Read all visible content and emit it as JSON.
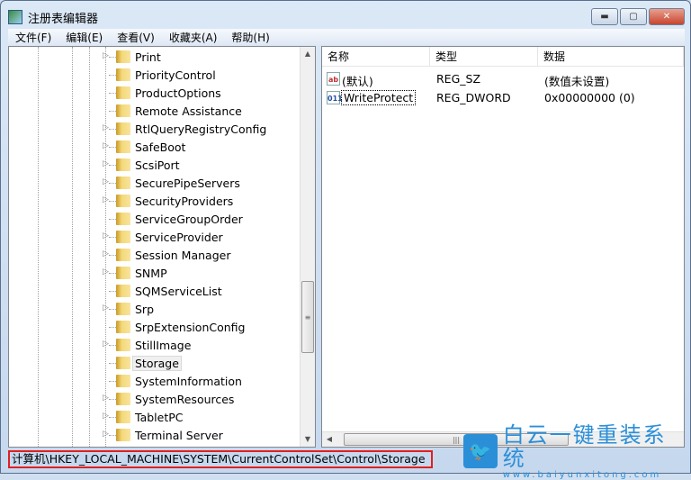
{
  "window": {
    "title": "注册表编辑器",
    "min": "▬",
    "max": "▢",
    "close": "✕"
  },
  "menu": [
    "文件(F)",
    "编辑(E)",
    "查看(V)",
    "收藏夹(A)",
    "帮助(H)"
  ],
  "tree": [
    {
      "label": "Print",
      "expandable": true
    },
    {
      "label": "PriorityControl",
      "expandable": false
    },
    {
      "label": "ProductOptions",
      "expandable": false
    },
    {
      "label": "Remote Assistance",
      "expandable": false
    },
    {
      "label": "RtlQueryRegistryConfig",
      "expandable": true
    },
    {
      "label": "SafeBoot",
      "expandable": true
    },
    {
      "label": "ScsiPort",
      "expandable": true
    },
    {
      "label": "SecurePipeServers",
      "expandable": true
    },
    {
      "label": "SecurityProviders",
      "expandable": true
    },
    {
      "label": "ServiceGroupOrder",
      "expandable": false
    },
    {
      "label": "ServiceProvider",
      "expandable": true
    },
    {
      "label": "Session Manager",
      "expandable": true
    },
    {
      "label": "SNMP",
      "expandable": true
    },
    {
      "label": "SQMServiceList",
      "expandable": false
    },
    {
      "label": "Srp",
      "expandable": true
    },
    {
      "label": "SrpExtensionConfig",
      "expandable": false
    },
    {
      "label": "StillImage",
      "expandable": true
    },
    {
      "label": "Storage",
      "expandable": false,
      "selected": true
    },
    {
      "label": "SystemInformation",
      "expandable": false
    },
    {
      "label": "SystemResources",
      "expandable": true
    },
    {
      "label": "TabletPC",
      "expandable": true
    },
    {
      "label": "Terminal Server",
      "expandable": true
    }
  ],
  "list": {
    "headers": [
      "名称",
      "类型",
      "数据"
    ],
    "rows": [
      {
        "icon": "string-value-icon",
        "icon_text": "ab",
        "name": "(默认)",
        "type": "REG_SZ",
        "data": "(数值未设置)"
      },
      {
        "icon": "binary-value-icon",
        "icon_text": "011",
        "name": "WriteProtect",
        "type": "REG_DWORD",
        "data": "0x00000000 (0)"
      }
    ]
  },
  "status": {
    "path": "计算机\\HKEY_LOCAL_MACHINE\\SYSTEM\\CurrentControlSet\\Control\\Storage"
  },
  "watermark": {
    "brand": "白云一键重装系统",
    "url": "www.baiyunxitong.com"
  },
  "colors": {
    "accent": "#2b8fd8",
    "highlight": "#e02020"
  }
}
